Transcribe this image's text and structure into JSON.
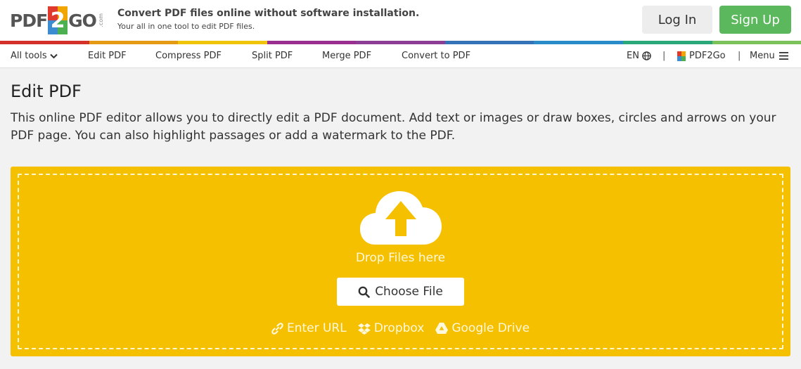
{
  "header": {
    "logo": {
      "left": "PDF",
      "mid": "2",
      "right": "GO",
      "suffix": ".com"
    },
    "tagline": "Convert PDF files online without software installation.",
    "subtagline": "Your all in one tool to edit PDF files.",
    "login_label": "Log In",
    "signup_label": "Sign Up"
  },
  "colors": {
    "accent_yellow": "#f5c000",
    "signup_green": "#5cb85c",
    "bar": [
      "#d4312b",
      "#e59a16",
      "#f0c40b",
      "#9b2f8f",
      "#8b3e94",
      "#3573b8",
      "#2a8bc9",
      "#2aa87a",
      "#7cc25a"
    ]
  },
  "nav": {
    "all_tools": "All tools",
    "items": [
      "Edit PDF",
      "Compress PDF",
      "Split PDF",
      "Merge PDF",
      "Convert to PDF"
    ],
    "language": "EN",
    "brand": "PDF2Go",
    "menu": "Menu",
    "separator": "|"
  },
  "main": {
    "title": "Edit PDF",
    "description": "This online PDF editor allows you to directly edit a PDF document. Add text or images or draw boxes, circles and arrows on your PDF page. You can also highlight passages or add a watermark to the PDF."
  },
  "upload": {
    "drop_text": "Drop Files here",
    "choose_label": "Choose File",
    "sources": [
      {
        "icon": "link-icon",
        "label": "Enter URL"
      },
      {
        "icon": "dropbox-icon",
        "label": "Dropbox"
      },
      {
        "icon": "google-drive-icon",
        "label": "Google Drive"
      }
    ]
  }
}
